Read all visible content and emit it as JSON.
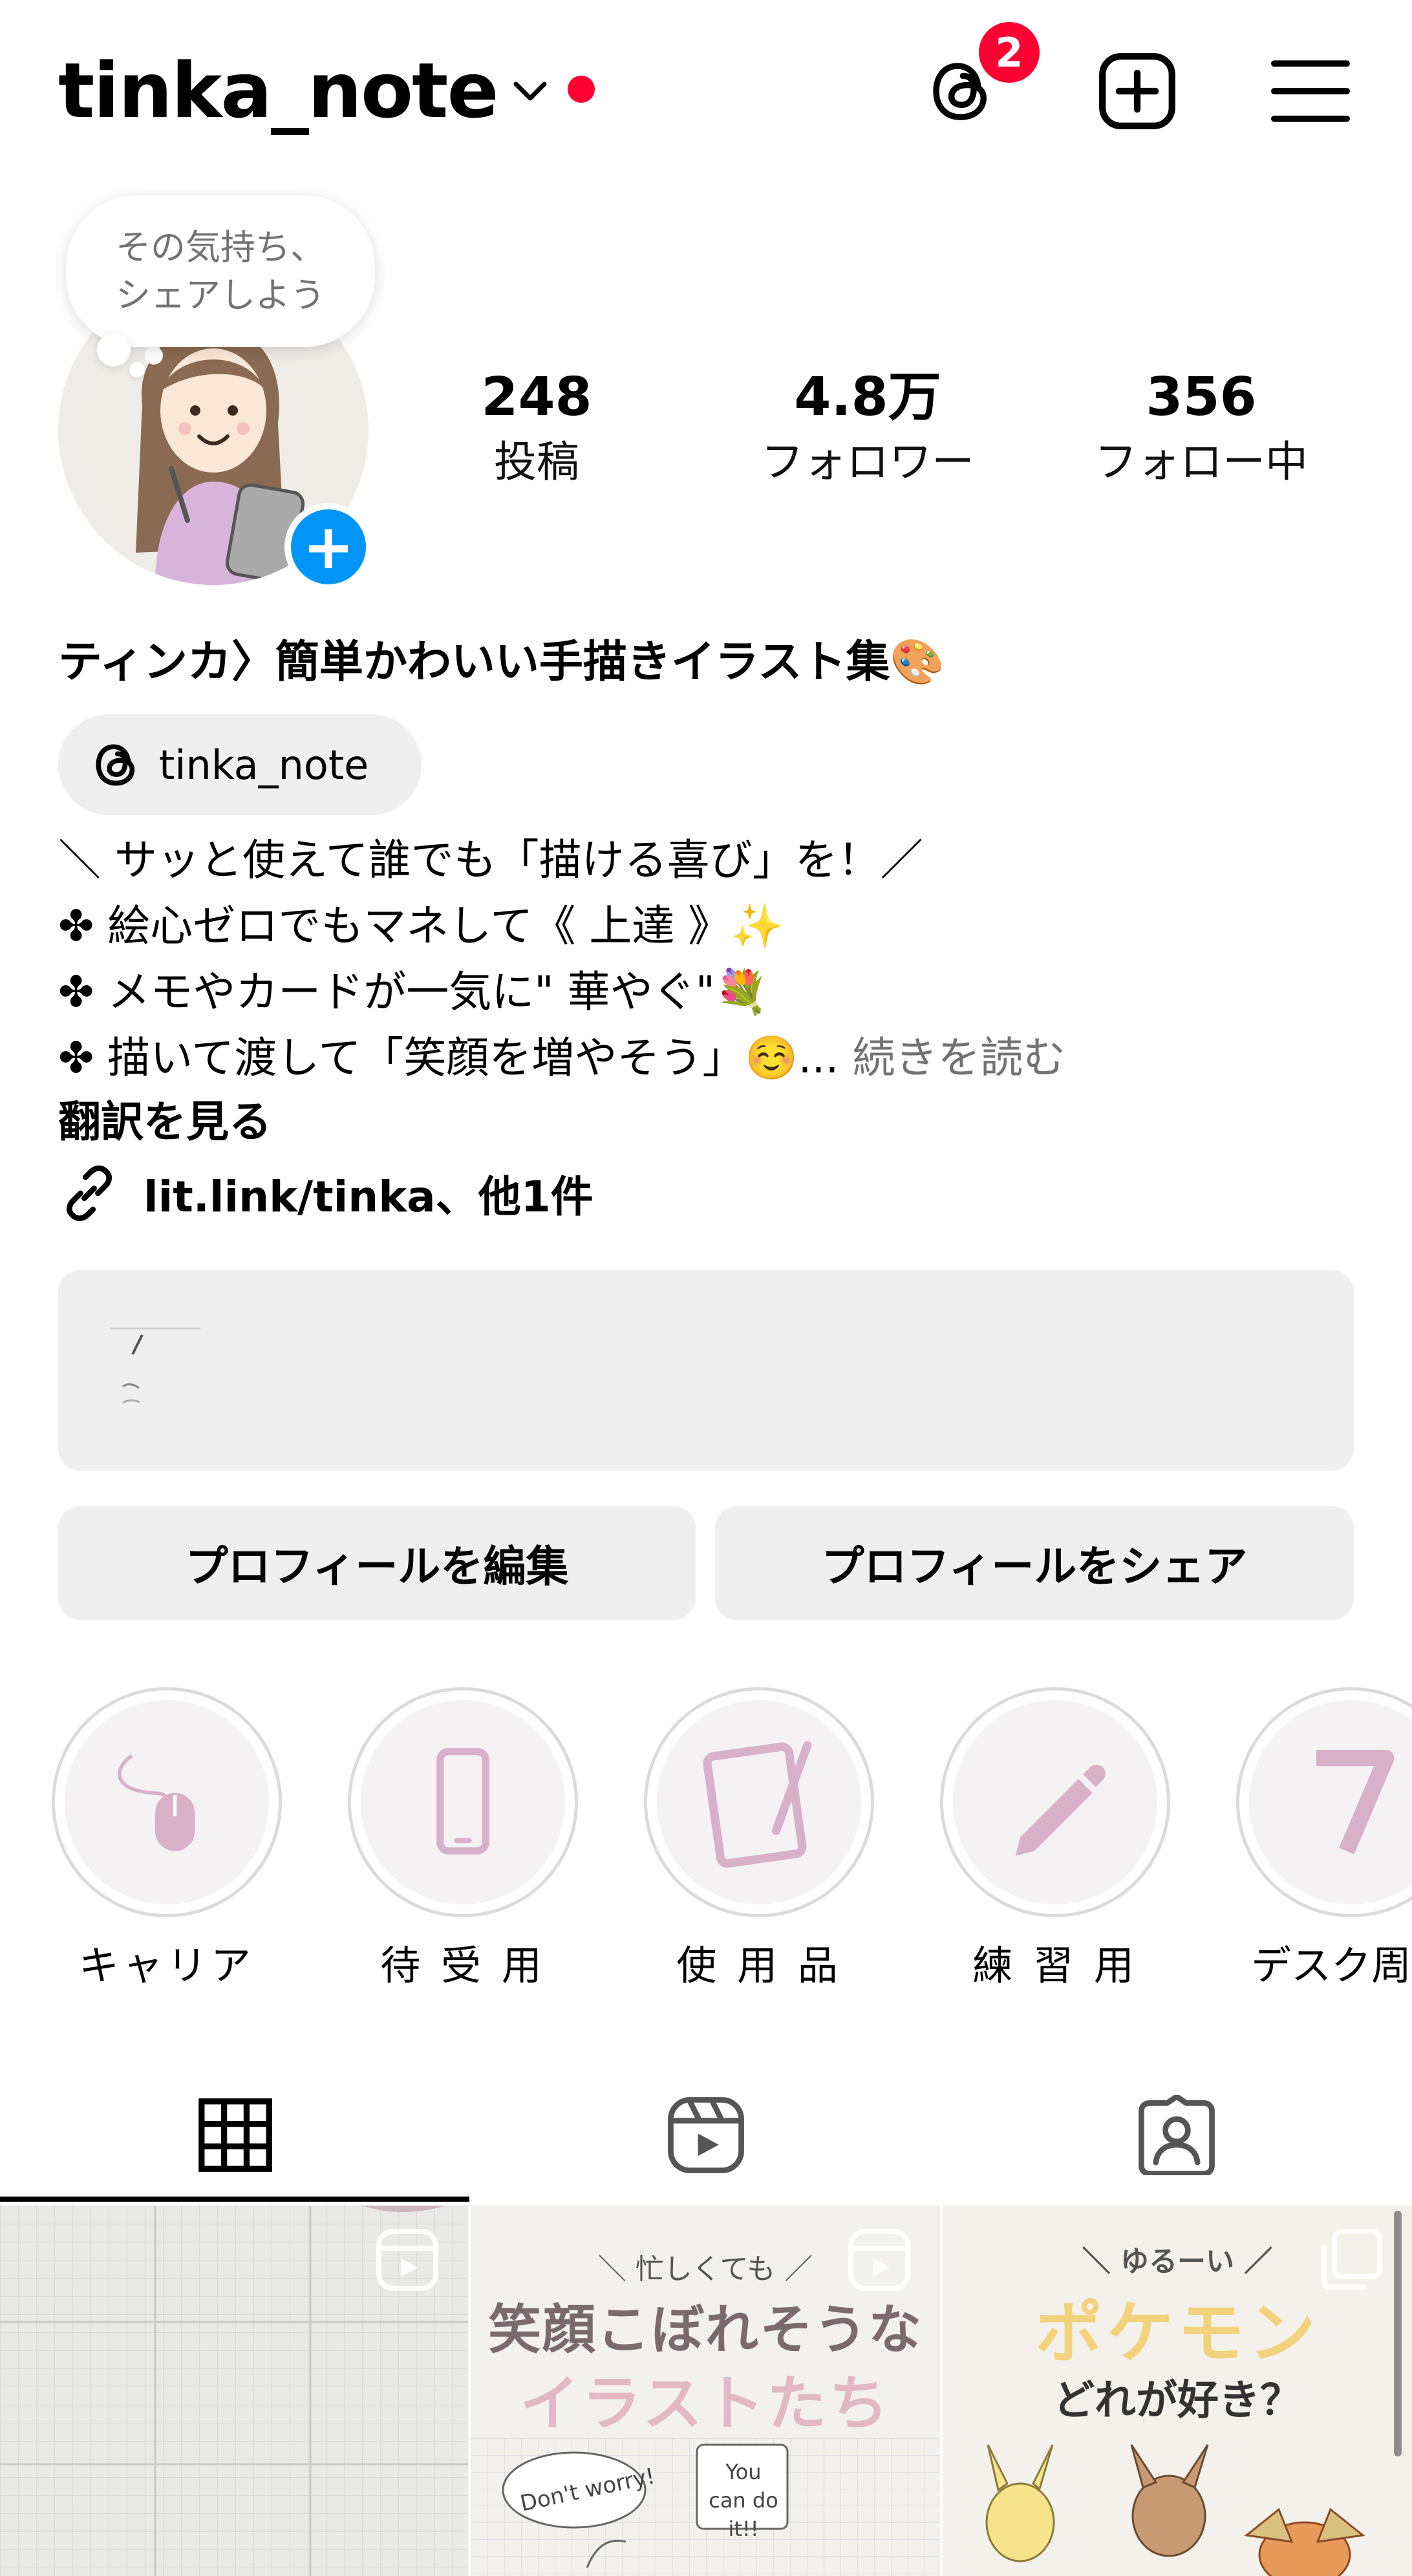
{
  "header": {
    "username": "tinka_note",
    "threads_badge": "2"
  },
  "note": {
    "line1": "その気持ち、",
    "line2": "シェアしよう"
  },
  "stats": [
    {
      "value": "248",
      "label": "投稿"
    },
    {
      "value": "4.8万",
      "label": "フォロワー"
    },
    {
      "value": "356",
      "label": "フォロー中"
    }
  ],
  "bio": {
    "name_line": "ティンカ〉簡単かわいい手描きイラスト集🎨",
    "threads_handle": "tinka_note",
    "lines": [
      "＼ サッと使えて誰でも「描ける喜び」を！／",
      "✤ 絵心ゼロでもマネして《 上達 》✨",
      "✤ メモやカードが一気に\" 華やぐ\"💐",
      "✤ 描いて渡して「笑顔を増やそう」☺️..."
    ],
    "more": " 続きを読む",
    "translate": "翻訳を見る",
    "link": "lit.link/tinka、他1件"
  },
  "buttons": {
    "edit": "プロフィールを編集",
    "share": "プロフィールをシェア"
  },
  "highlights": [
    {
      "label": "キャリア",
      "icon": "mouse-icon"
    },
    {
      "label": "待 受 用",
      "icon": "smartphone-icon"
    },
    {
      "label": "使 用 品",
      "icon": "tablet-pen-icon"
    },
    {
      "label": "練 習 用",
      "icon": "pencil-icon"
    },
    {
      "label": "デスク周り",
      "icon": "number-7-icon"
    }
  ],
  "tabs": [
    {
      "name": "posts",
      "icon": "grid-icon"
    },
    {
      "name": "reels",
      "icon": "reels-icon"
    },
    {
      "name": "tagged",
      "icon": "tagged-person-icon"
    }
  ],
  "posts": [
    {
      "type": "reel"
    },
    {
      "type": "reel",
      "small_top": "＼ 忙しくても ／",
      "title1": "笑顔こぼれそうな",
      "title2": "イラストたち",
      "bubble1": "Don't worry!",
      "bubble2": "You can do it!!"
    },
    {
      "type": "carousel",
      "small_top": "＼ ゆるーい ／",
      "title1": "ポケモン",
      "title2": "どれが好き？"
    }
  ],
  "colors": {
    "accent_blue": "#0095f6",
    "badge_red": "#ff0033",
    "highlight_pink": "#d8b0c8",
    "button_gray": "#efefef"
  }
}
